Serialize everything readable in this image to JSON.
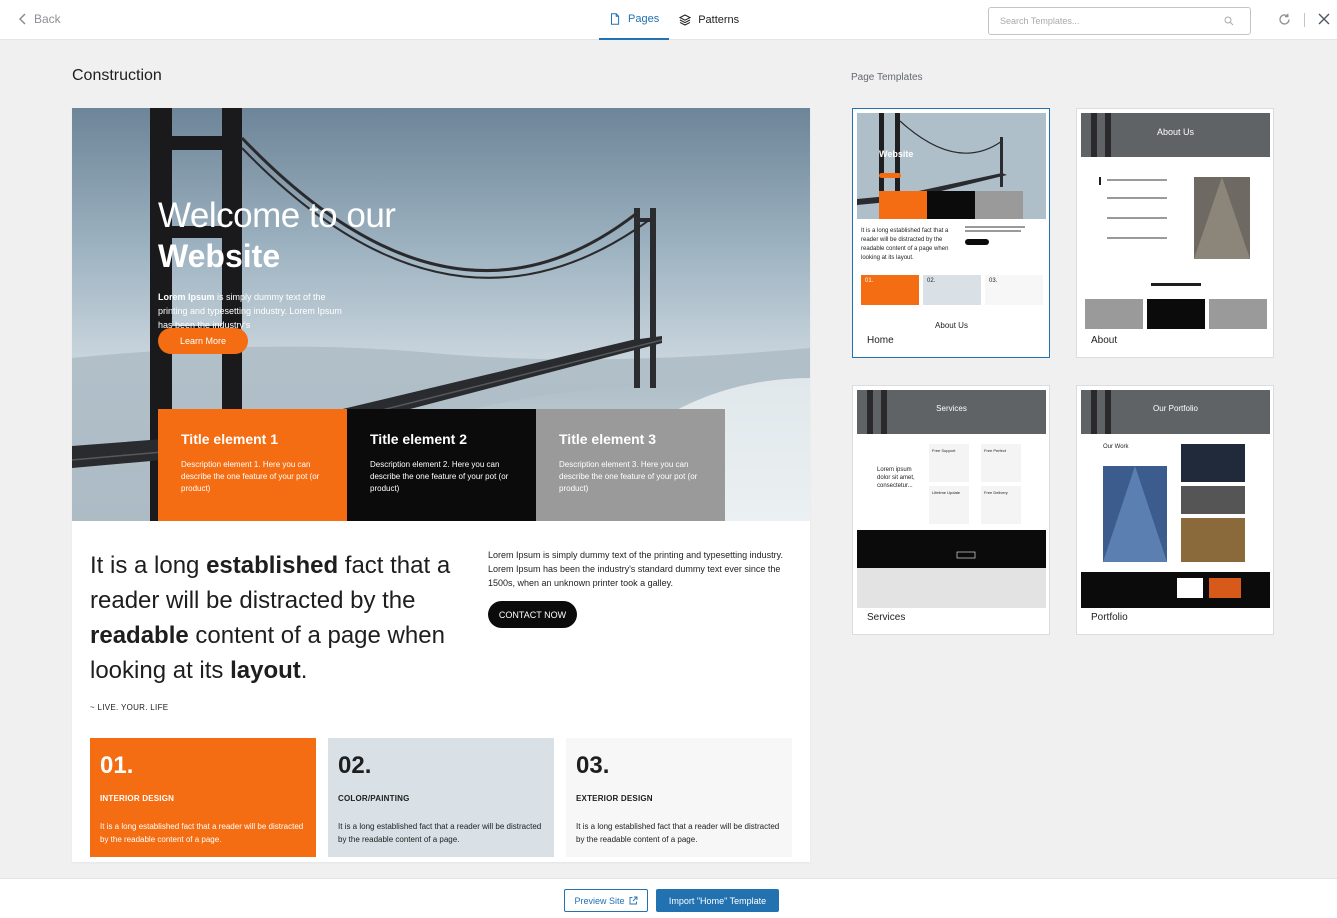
{
  "topbar": {
    "back_label": "Back",
    "tabs": [
      {
        "label": "Pages",
        "icon": "page-icon",
        "active": true
      },
      {
        "label": "Patterns",
        "icon": "layers-icon",
        "active": false
      }
    ],
    "search": {
      "placeholder": "Search Templates...",
      "value": ""
    }
  },
  "site_name": "Construction",
  "templates_heading": "Page Templates",
  "preview": {
    "hero": {
      "line1": "Welcome to our",
      "line2": "Website",
      "desc_bold": "Lorem Ipsum",
      "desc_rest": " is simply dummy text of the printing and typesetting industry. Lorem Ipsum has been the industry's",
      "button": "Learn More"
    },
    "tiles": [
      {
        "title": "Title element 1",
        "desc": "Description element 1. Here you can describe the one feature of your pot (or product)"
      },
      {
        "title": "Title element 2",
        "desc": "Description element 2. Here you can describe the one feature of your pot (or product)"
      },
      {
        "title": "Title element 3",
        "desc": "Description element 3. Here you can describe the one feature of your pot (or product)"
      }
    ],
    "quote": {
      "p1": "It is a long ",
      "b1": "established",
      "p2": " fact that a reader will be distracted by the ",
      "b2": "readable",
      "p3": " content of a page when looking at its ",
      "b3": "layout",
      "p4": ".",
      "author": "~ LIVE. YOUR. LIFE"
    },
    "intro": {
      "text": "Lorem Ipsum is simply dummy text of the printing and typesetting industry. Lorem Ipsum has been the industry's standard dummy text ever since the 1500s, when an unknown printer took a galley.",
      "button": "CONTACT NOW"
    },
    "cards": [
      {
        "num": "01.",
        "label": "INTERIOR DESIGN",
        "text": "It is a long established fact that a reader will be distracted by the readable content of a page."
      },
      {
        "num": "02.",
        "label": "COLOR/PAINTING",
        "text": "It is a long established fact that a reader will be distracted by the readable content of a page."
      },
      {
        "num": "03.",
        "label": "EXTERIOR DESIGN",
        "text": "It is a long established fact that a reader will be distracted by the readable content of a page."
      }
    ]
  },
  "templates": [
    {
      "name": "Home",
      "selected": true
    },
    {
      "name": "About",
      "selected": false
    },
    {
      "name": "Services",
      "selected": false
    },
    {
      "name": "Portfolio",
      "selected": false
    }
  ],
  "thumbs": {
    "home_title": "Website",
    "home_text": "It is a long established fact that a reader will be distracted by the readable content of a page when looking at its layout.",
    "home_nums": [
      "01.",
      "02.",
      "03."
    ],
    "home_about": "About Us",
    "about_title": "About Us",
    "services_title": "Services",
    "services_text": "Lorem ipsum dolor sit amet, consectetur...",
    "services_boxes": [
      "Free Support",
      "Free Perfect",
      "Lifetime Update",
      "Free Delivery"
    ],
    "portfolio_title": "Our Portfolio",
    "portfolio_work": "Our Work"
  },
  "bottombar": {
    "preview_label": "Preview Site",
    "import_label": "Import \"Home\" Template"
  },
  "colors": {
    "accent": "#2271b1",
    "orange": "#f46d12",
    "dark": "#0b0b0b",
    "grey": "#9a9a9a"
  }
}
